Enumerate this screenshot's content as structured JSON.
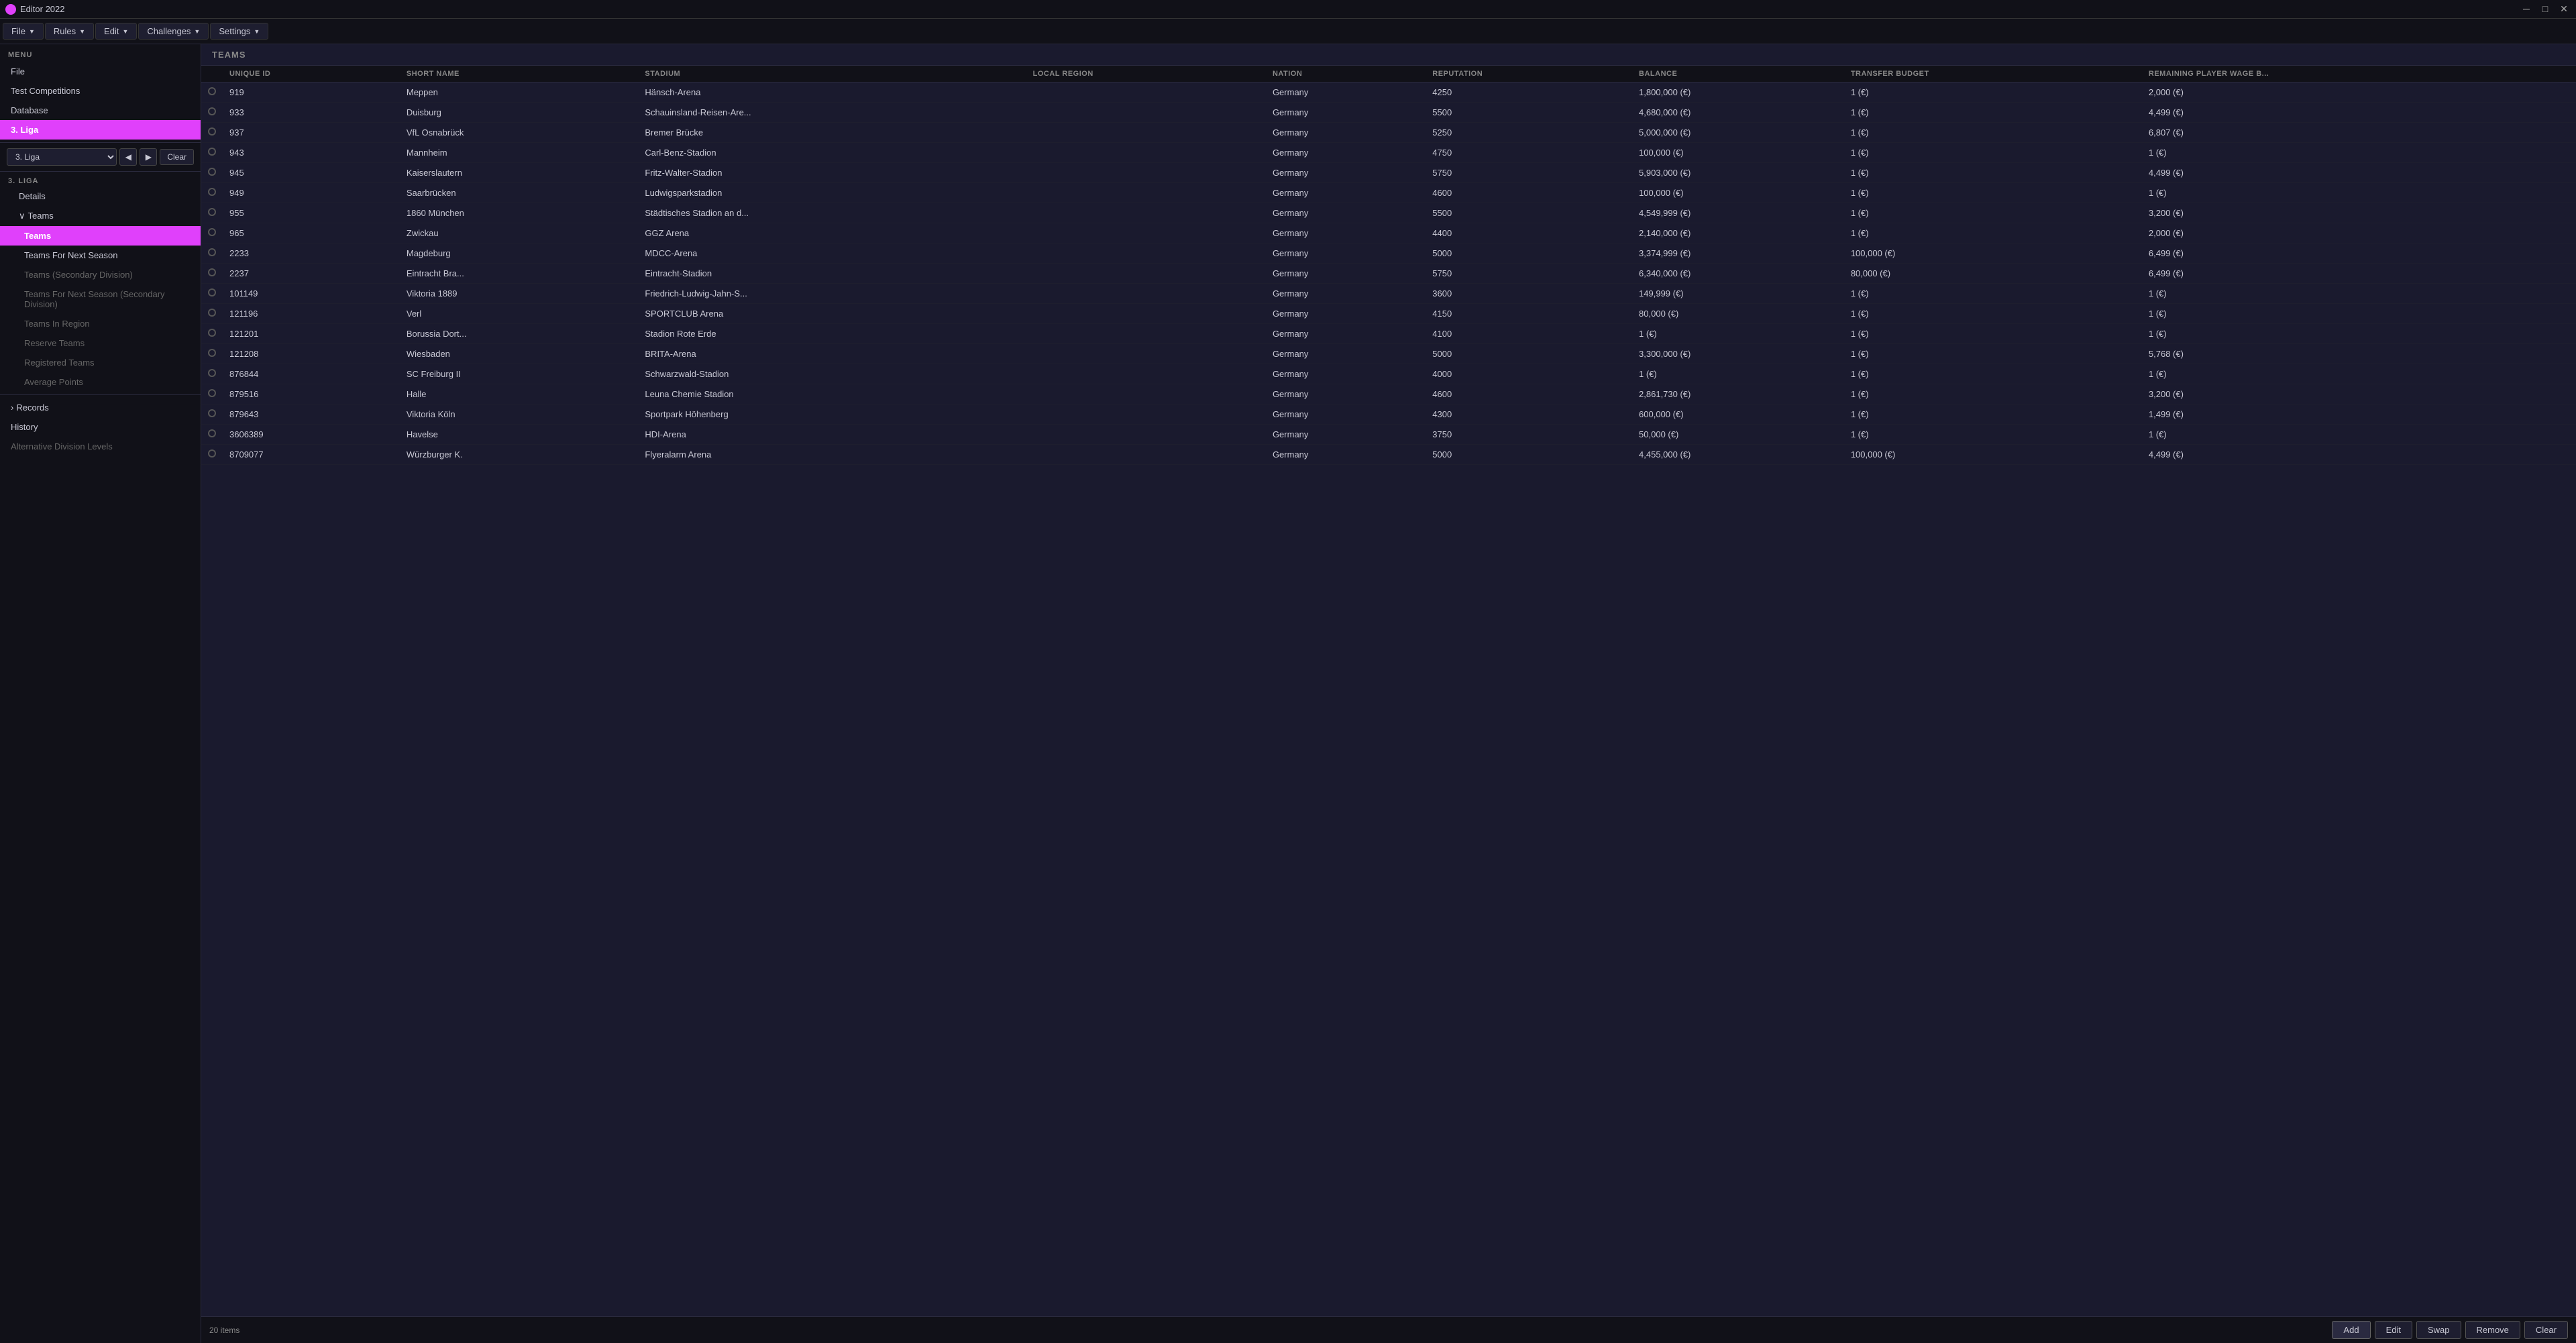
{
  "titlebar": {
    "title": "Editor 2022",
    "minimize": "─",
    "maximize": "□",
    "close": "✕"
  },
  "menubar": {
    "file_label": "File",
    "rules_label": "Rules",
    "edit_label": "Edit",
    "challenges_label": "Challenges",
    "settings_label": "Settings"
  },
  "sidebar": {
    "menu_label": "MENU",
    "items": [
      {
        "id": "file",
        "label": "File",
        "indent": 0
      },
      {
        "id": "test-competitions",
        "label": "Test Competitions",
        "indent": 0
      },
      {
        "id": "database",
        "label": "Database",
        "indent": 0
      },
      {
        "id": "3liga",
        "label": "3. Liga",
        "indent": 0,
        "active": true
      }
    ],
    "liga_label": "3. LIGA",
    "liga_items": [
      {
        "id": "details",
        "label": "Details",
        "indent": 1
      },
      {
        "id": "teams-group",
        "label": "Teams",
        "indent": 1,
        "expandable": true
      },
      {
        "id": "teams",
        "label": "Teams",
        "indent": 2,
        "active": true
      },
      {
        "id": "teams-for-next-season",
        "label": "Teams For Next Season",
        "indent": 2
      },
      {
        "id": "teams-secondary",
        "label": "Teams (Secondary Division)",
        "indent": 2,
        "muted": true
      },
      {
        "id": "teams-next-secondary",
        "label": "Teams For Next Season (Secondary Division)",
        "indent": 2,
        "muted": true
      },
      {
        "id": "teams-in-region",
        "label": "Teams In Region",
        "indent": 2,
        "muted": true
      },
      {
        "id": "reserve-teams",
        "label": "Reserve Teams",
        "indent": 2,
        "muted": true
      },
      {
        "id": "registered-teams",
        "label": "Registered Teams",
        "indent": 2,
        "muted": true
      },
      {
        "id": "average-points",
        "label": "Average Points",
        "indent": 2,
        "muted": true
      }
    ],
    "records_label": "Records",
    "history_label": "History",
    "alt_div_label": "Alternative Division Levels"
  },
  "league_selector": {
    "selected": "3. Liga",
    "clear_label": "Clear"
  },
  "content": {
    "section_label": "TEAMS",
    "columns": [
      {
        "id": "radio",
        "label": ""
      },
      {
        "id": "unique-id",
        "label": "UNIQUE ID"
      },
      {
        "id": "short-name",
        "label": "SHORT NAME"
      },
      {
        "id": "stadium",
        "label": "STADIUM"
      },
      {
        "id": "local-region",
        "label": "LOCAL REGION"
      },
      {
        "id": "nation",
        "label": "NATION"
      },
      {
        "id": "reputation",
        "label": "REPUTATION"
      },
      {
        "id": "balance",
        "label": "BALANCE"
      },
      {
        "id": "transfer-budget",
        "label": "TRANSFER BUDGET"
      },
      {
        "id": "remaining-wage",
        "label": "REMAINING PLAYER WAGE B..."
      }
    ],
    "rows": [
      {
        "id": "919",
        "short": "Meppen",
        "stadium": "Hänsch-Arena",
        "region": "",
        "nation": "Germany",
        "rep": "4250",
        "balance": "1,800,000 (€)",
        "transfer": "1 (€)",
        "wage": "2,000 (€)"
      },
      {
        "id": "933",
        "short": "Duisburg",
        "stadium": "Schauinsland-Reisen-Are...",
        "region": "",
        "nation": "Germany",
        "rep": "5500",
        "balance": "4,680,000 (€)",
        "transfer": "1 (€)",
        "wage": "4,499 (€)"
      },
      {
        "id": "937",
        "short": "VfL Osnabrück",
        "stadium": "Bremer Brücke",
        "region": "",
        "nation": "Germany",
        "rep": "5250",
        "balance": "5,000,000 (€)",
        "transfer": "1 (€)",
        "wage": "6,807 (€)"
      },
      {
        "id": "943",
        "short": "Mannheim",
        "stadium": "Carl-Benz-Stadion",
        "region": "",
        "nation": "Germany",
        "rep": "4750",
        "balance": "100,000 (€)",
        "transfer": "1 (€)",
        "wage": "1 (€)"
      },
      {
        "id": "945",
        "short": "Kaiserslautern",
        "stadium": "Fritz-Walter-Stadion",
        "region": "",
        "nation": "Germany",
        "rep": "5750",
        "balance": "5,903,000 (€)",
        "transfer": "1 (€)",
        "wage": "4,499 (€)"
      },
      {
        "id": "949",
        "short": "Saarbrücken",
        "stadium": "Ludwigsparkstadion",
        "region": "",
        "nation": "Germany",
        "rep": "4600",
        "balance": "100,000 (€)",
        "transfer": "1 (€)",
        "wage": "1 (€)"
      },
      {
        "id": "955",
        "short": "1860 München",
        "stadium": "Städtisches Stadion an d...",
        "region": "",
        "nation": "Germany",
        "rep": "5500",
        "balance": "4,549,999 (€)",
        "transfer": "1 (€)",
        "wage": "3,200 (€)"
      },
      {
        "id": "965",
        "short": "Zwickau",
        "stadium": "GGZ Arena",
        "region": "",
        "nation": "Germany",
        "rep": "4400",
        "balance": "2,140,000 (€)",
        "transfer": "1 (€)",
        "wage": "2,000 (€)"
      },
      {
        "id": "2233",
        "short": "Magdeburg",
        "stadium": "MDCC-Arena",
        "region": "",
        "nation": "Germany",
        "rep": "5000",
        "balance": "3,374,999 (€)",
        "transfer": "100,000 (€)",
        "wage": "6,499 (€)"
      },
      {
        "id": "2237",
        "short": "Eintracht Bra...",
        "stadium": "Eintracht-Stadion",
        "region": "",
        "nation": "Germany",
        "rep": "5750",
        "balance": "6,340,000 (€)",
        "transfer": "80,000 (€)",
        "wage": "6,499 (€)"
      },
      {
        "id": "101149",
        "short": "Viktoria 1889",
        "stadium": "Friedrich-Ludwig-Jahn-S...",
        "region": "",
        "nation": "Germany",
        "rep": "3600",
        "balance": "149,999 (€)",
        "transfer": "1 (€)",
        "wage": "1 (€)"
      },
      {
        "id": "121196",
        "short": "Verl",
        "stadium": "SPORTCLUB Arena",
        "region": "",
        "nation": "Germany",
        "rep": "4150",
        "balance": "80,000 (€)",
        "transfer": "1 (€)",
        "wage": "1 (€)"
      },
      {
        "id": "121201",
        "short": "Borussia Dort...",
        "stadium": "Stadion Rote Erde",
        "region": "",
        "nation": "Germany",
        "rep": "4100",
        "balance": "1 (€)",
        "transfer": "1 (€)",
        "wage": "1 (€)"
      },
      {
        "id": "121208",
        "short": "Wiesbaden",
        "stadium": "BRITA-Arena",
        "region": "",
        "nation": "Germany",
        "rep": "5000",
        "balance": "3,300,000 (€)",
        "transfer": "1 (€)",
        "wage": "5,768 (€)"
      },
      {
        "id": "876844",
        "short": "SC Freiburg II",
        "stadium": "Schwarzwald-Stadion",
        "region": "",
        "nation": "Germany",
        "rep": "4000",
        "balance": "1 (€)",
        "transfer": "1 (€)",
        "wage": "1 (€)"
      },
      {
        "id": "879516",
        "short": "Halle",
        "stadium": "Leuna Chemie Stadion",
        "region": "",
        "nation": "Germany",
        "rep": "4600",
        "balance": "2,861,730 (€)",
        "transfer": "1 (€)",
        "wage": "3,200 (€)"
      },
      {
        "id": "879643",
        "short": "Viktoria Köln",
        "stadium": "Sportpark Höhenberg",
        "region": "",
        "nation": "Germany",
        "rep": "4300",
        "balance": "600,000 (€)",
        "transfer": "1 (€)",
        "wage": "1,499 (€)"
      },
      {
        "id": "3606389",
        "short": "Havelse",
        "stadium": "HDI-Arena",
        "region": "",
        "nation": "Germany",
        "rep": "3750",
        "balance": "50,000 (€)",
        "transfer": "1 (€)",
        "wage": "1 (€)"
      },
      {
        "id": "8709077",
        "short": "Würzburger K.",
        "stadium": "Flyeralarm Arena",
        "region": "",
        "nation": "Germany",
        "rep": "5000",
        "balance": "4,455,000 (€)",
        "transfer": "100,000 (€)",
        "wage": "4,499 (€)"
      }
    ],
    "items_count": "20 items"
  },
  "footer": {
    "add_label": "Add",
    "edit_label": "Edit",
    "swap_label": "Swap",
    "remove_label": "Remove",
    "clear_label": "Clear"
  }
}
